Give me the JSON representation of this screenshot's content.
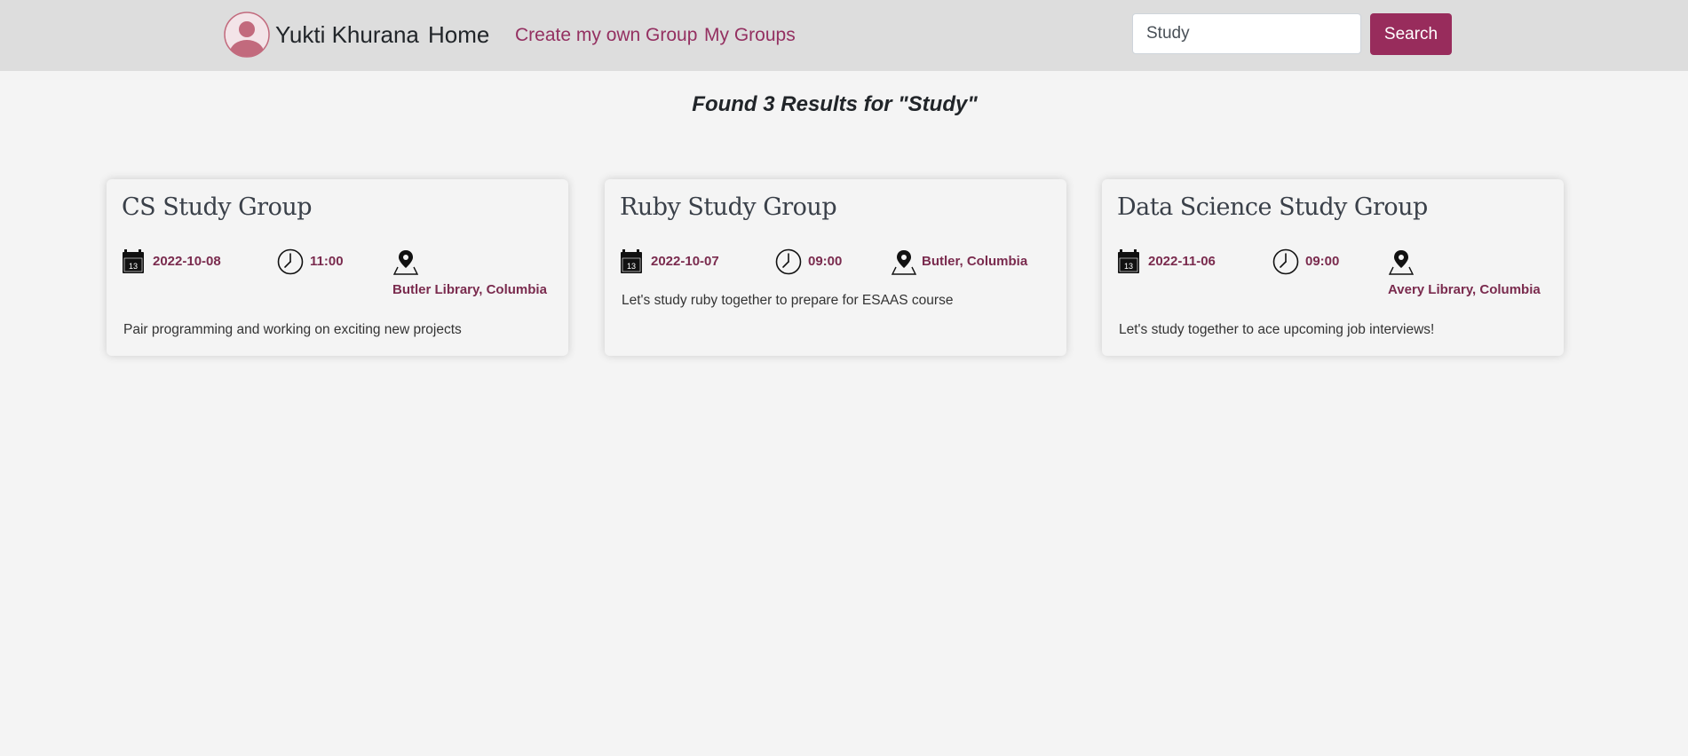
{
  "nav": {
    "username": "Yukti Khurana",
    "home": "Home",
    "links": [
      "Create my own Group",
      "My Groups"
    ],
    "avatar_icon": "user-avatar-icon"
  },
  "search": {
    "value": "Study",
    "button_label": "Search"
  },
  "results": {
    "heading": "Found 3 Results for \"Study\""
  },
  "groups": [
    {
      "title": "CS Study Group",
      "date": "2022-10-08",
      "time": "11:00",
      "location": "Butler Library, Columbia",
      "description": "Pair programming and working on exciting new projects"
    },
    {
      "title": "Ruby Study Group",
      "date": "2022-10-07",
      "time": "09:00",
      "location": "Butler, Columbia",
      "description": "Let's study ruby together to prepare for ESAAS course"
    },
    {
      "title": "Data Science Study Group",
      "date": "2022-11-06",
      "time": "09:00",
      "location": "Avery Library, Columbia",
      "description": "Let's study together to ace upcoming job interviews!"
    }
  ],
  "icons": {
    "date": "calendar-icon",
    "time": "clock-icon",
    "location": "map-pin-icon",
    "calendar_day": "13"
  },
  "colors": {
    "accent": "#982c5c",
    "link": "#943061",
    "meta_text": "#7a2b4e",
    "navbar_bg": "#dddddd",
    "page_bg": "#f4f4f4",
    "avatar": "#c26a7d"
  }
}
